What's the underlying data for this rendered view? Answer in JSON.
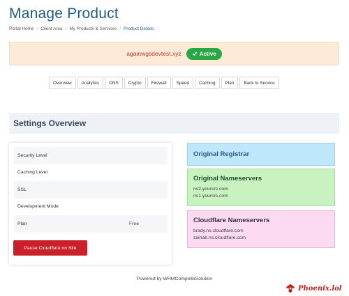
{
  "page": {
    "title": "Manage Product"
  },
  "breadcrumb": [
    "Portal Home",
    "Client Area",
    "My Products & Services",
    "Product Details"
  ],
  "domain_banner": {
    "domain": "againwgsdevtest.xyz",
    "status": "Active"
  },
  "tabs": [
    "Overview",
    "Analytics",
    "DNS",
    "Crypto",
    "Firewall",
    "Speed",
    "Caching",
    "Plan",
    "Back to Service"
  ],
  "settings": {
    "header": "Settings Overview",
    "rows": [
      {
        "label": "Security Level",
        "value": ""
      },
      {
        "label": "Caching Level",
        "value": ""
      },
      {
        "label": "SSL",
        "value": ""
      },
      {
        "label": "Development Mode",
        "value": ""
      },
      {
        "label": "Plan",
        "value": "Free"
      }
    ],
    "pause_button": "Pause Cloudflare on Site"
  },
  "registrar": {
    "title": "Original Registrar"
  },
  "original_nameservers": {
    "title": "Original Nameservers",
    "servers": [
      "ns2.yoursrs.com",
      "ns1.yoursrs.com"
    ]
  },
  "cloudflare_nameservers": {
    "title": "Cloudflare Nameservers",
    "servers": [
      "brady.ns.cloudflare.com",
      "zainab.ns.cloudflare.com"
    ]
  },
  "footer": {
    "text": "Powered by WHMCompleteSolution"
  },
  "watermark": {
    "text": "Phoenix.lol",
    "icon": "phoenix-logo-icon"
  },
  "colors": {
    "title": "#1f5c86",
    "domain": "#c0392b",
    "active": "#28a745",
    "pause": "#c9202a"
  }
}
